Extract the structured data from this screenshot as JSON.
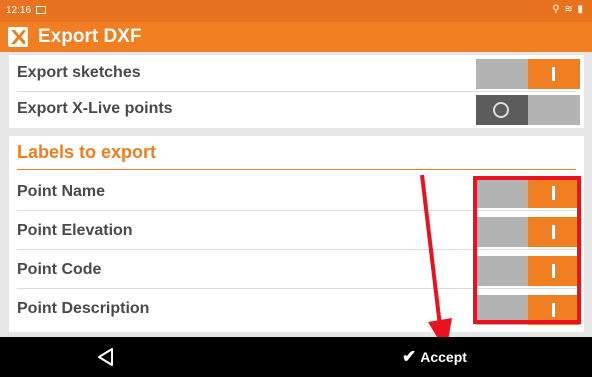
{
  "status_bar": {
    "time": "12:16",
    "system_icons": "⚲ ≋ ▮"
  },
  "app_bar": {
    "title": "Export DXF",
    "logo_icon": "x-logo-icon"
  },
  "settings": [
    {
      "label": "Export sketches",
      "toggle": "on"
    },
    {
      "label": "Export X-Live points",
      "toggle": "off"
    }
  ],
  "labels_section": {
    "title": "Labels to export",
    "items": [
      {
        "label": "Point Name",
        "toggle": "on"
      },
      {
        "label": "Point Elevation",
        "toggle": "on"
      },
      {
        "label": "Point Code",
        "toggle": "on"
      },
      {
        "label": "Point Description",
        "toggle": "on"
      }
    ]
  },
  "nav_bar": {
    "back_icon": "back-triangle-icon",
    "accept_label": "Accept"
  },
  "colors": {
    "accent": "#ef7f21",
    "annotation": "#e8131e",
    "toggle_off": "#b3b3b3"
  }
}
